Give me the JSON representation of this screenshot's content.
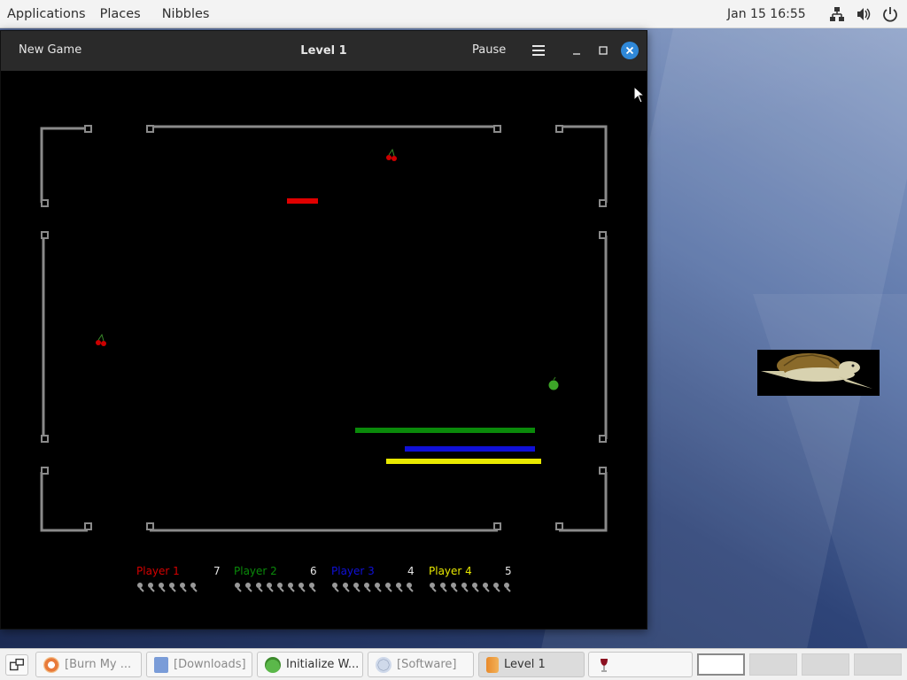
{
  "topbar": {
    "menus": [
      "Applications",
      "Places",
      "Nibbles"
    ],
    "clock": "Jan 15  16:55",
    "tray_icons": [
      "network-icon",
      "volume-icon",
      "power-icon"
    ]
  },
  "window": {
    "title": "Level 1",
    "new_game_label": "New Game",
    "pause_label": "Pause",
    "buttons": [
      "hamburger-menu-icon",
      "minimize-icon",
      "maximize-icon",
      "close-icon"
    ],
    "accent_color": "#2f88d8"
  },
  "players": [
    {
      "name": "Player 1",
      "score": "7",
      "color": "#d40000",
      "lives": 6
    },
    {
      "name": "Player 2",
      "score": "6",
      "color": "#0a8a0a",
      "lives": 8
    },
    {
      "name": "Player 3",
      "score": "4",
      "color": "#1010d8",
      "lives": 8
    },
    {
      "name": "Player 4",
      "score": "5",
      "color": "#e8e800",
      "lives": 8
    }
  ],
  "taskbar": {
    "tasks": [
      {
        "label": "[Burn My ...",
        "icon": "burn-my-windows-icon",
        "state": "minimized"
      },
      {
        "label": "[Downloads]",
        "icon": "folder-icon",
        "state": "minimized"
      },
      {
        "label": "Initialize W...",
        "icon": "android-robot-icon",
        "state": "normal"
      },
      {
        "label": "[Software]",
        "icon": "software-globe-icon",
        "state": "minimized"
      },
      {
        "label": "Level 1",
        "icon": "nibbles-worm-icon",
        "state": "active"
      },
      {
        "label": "",
        "icon": "wine-glass-icon",
        "state": "normal"
      }
    ],
    "workspaces": 4,
    "active_workspace": 1
  }
}
